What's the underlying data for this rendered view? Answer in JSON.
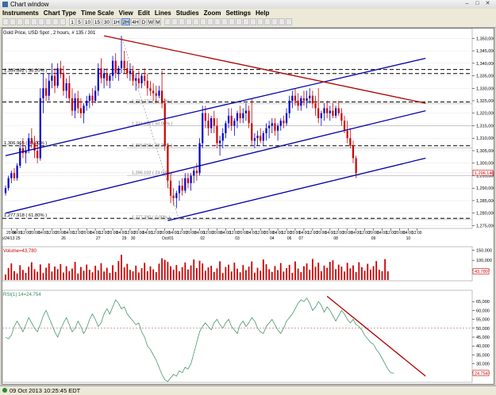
{
  "window": {
    "title": "Chart window"
  },
  "menu": [
    "Instruments",
    "Chart Type",
    "Time Scale",
    "View",
    "Edit",
    "Lines",
    "Studies",
    "Zoom",
    "Settings",
    "Help"
  ],
  "toolbar": {
    "timeframes": [
      "1",
      "5",
      "10",
      "15",
      "30",
      "1H",
      "2H",
      "4H",
      "D",
      "W",
      "M"
    ],
    "active_timeframe": "2H"
  },
  "chart_header": "Gold Price, USD Spot , 2 hours, # 135 / 301",
  "colors": {
    "bull": "#0000cc",
    "bear": "#cc0000",
    "volume": "#cc0000",
    "rsi": "#2e8b57",
    "channel": "#0000aa",
    "trendline": "#b00000",
    "dashed": "#000000",
    "fib": "#9a9a9a",
    "current": "#cc0000"
  },
  "price_axis": [
    {
      "v": 1350000,
      "label": "1,350,000"
    },
    {
      "v": 1345000,
      "label": "1,345,000"
    },
    {
      "v": 1340000,
      "label": "1,340,000"
    },
    {
      "v": 1335000,
      "label": "1,335,000"
    },
    {
      "v": 1330000,
      "label": "1,330,000"
    },
    {
      "v": 1325000,
      "label": "1,325,000"
    },
    {
      "v": 1320000,
      "label": "1,320,000"
    },
    {
      "v": 1315000,
      "label": "1,315,000"
    },
    {
      "v": 1310000,
      "label": "1,310,000"
    },
    {
      "v": 1305000,
      "label": "1,305,000"
    },
    {
      "v": 1300000,
      "label": "1,300,000"
    },
    {
      "v": 1295000,
      "label": "1,295,000"
    },
    {
      "v": 1290000,
      "label": "1,290,000"
    },
    {
      "v": 1285000,
      "label": "1,285,000"
    },
    {
      "v": 1280000,
      "label": "1,280,000"
    },
    {
      "v": 1275000,
      "label": "1,275,000"
    }
  ],
  "current_price": {
    "value": 1296140,
    "label": "1,296,140"
  },
  "fib_levels": [
    {
      "v": 1335882,
      "label": "1,335.882 ( 38.20% )",
      "pos": "left",
      "style": "dashed"
    },
    {
      "v": 1323771,
      "label": "1,323.771 ( 61.80% )",
      "pos": "mid",
      "style": "fib"
    },
    {
      "v": 1314915,
      "label": "1,314.915 ( 50.00% )",
      "pos": "mid",
      "style": "fib"
    },
    {
      "v": 1306965,
      "label": "1,306.965 ( 50.00% )",
      "pos": "left",
      "style": "dashed"
    },
    {
      "v": 1306059,
      "label": "1,306.059 ( 38.20% )",
      "pos": "mid",
      "style": "fib"
    },
    {
      "v": 1295102,
      "label": "1,295.102 ( 23.60% )",
      "pos": "mid",
      "style": "fib"
    },
    {
      "v": 1277918,
      "label": "1,277.918 ( 61.80% )",
      "pos": "left",
      "style": "dashed"
    },
    {
      "v": 1277390,
      "label": "1,277.390 ( 0.00% )",
      "pos": "mid",
      "style": "fib"
    }
  ],
  "extra_dashed": [
    1337500,
    1324500
  ],
  "time_axis": {
    "top": [
      {
        "i": 2,
        "t": "20:00"
      },
      {
        "i": 4,
        "t": "04:00"
      },
      {
        "i": 7,
        "t": "12:00"
      },
      {
        "i": 10,
        "t": "20:00"
      },
      {
        "i": 13,
        "t": "04:00"
      },
      {
        "i": 16,
        "t": "12:00"
      },
      {
        "i": 19,
        "t": "20:00"
      },
      {
        "i": 22,
        "t": "04:00"
      },
      {
        "i": 25,
        "t": "12:00"
      },
      {
        "i": 28,
        "t": "20:00"
      },
      {
        "i": 31,
        "t": "04:00"
      },
      {
        "i": 34,
        "t": "12:00"
      },
      {
        "i": 37,
        "t": "20:00"
      },
      {
        "i": 40,
        "t": "04:00"
      },
      {
        "i": 43,
        "t": "12:00"
      },
      {
        "i": 46,
        "t": "20:00"
      },
      {
        "i": 49,
        "t": "04:00"
      },
      {
        "i": 52,
        "t": "12:00"
      },
      {
        "i": 55,
        "t": "20:00"
      },
      {
        "i": 58,
        "t": "04:00"
      },
      {
        "i": 61,
        "t": "12:00"
      },
      {
        "i": 64,
        "t": "20:00"
      },
      {
        "i": 67,
        "t": "04:00"
      },
      {
        "i": 70,
        "t": "12:00"
      },
      {
        "i": 73,
        "t": "20:00"
      },
      {
        "i": 76,
        "t": "04:00"
      },
      {
        "i": 79,
        "t": "12:00"
      },
      {
        "i": 82,
        "t": "20:00"
      },
      {
        "i": 85,
        "t": "04:00"
      },
      {
        "i": 88,
        "t": "12:00"
      },
      {
        "i": 91,
        "t": "20:00"
      },
      {
        "i": 94,
        "t": "04:00"
      },
      {
        "i": 97,
        "t": "12:00"
      },
      {
        "i": 100,
        "t": "20:00"
      },
      {
        "i": 103,
        "t": "04:00"
      },
      {
        "i": 106,
        "t": "12:00"
      },
      {
        "i": 109,
        "t": "20:00"
      },
      {
        "i": 112,
        "t": "04:00"
      },
      {
        "i": 115,
        "t": "12:00"
      },
      {
        "i": 118,
        "t": "20:00"
      },
      {
        "i": 121,
        "t": "04:00"
      },
      {
        "i": 124,
        "t": "12:00"
      },
      {
        "i": 127,
        "t": "20:00"
      },
      {
        "i": 130,
        "t": "04:00"
      },
      {
        "i": 133,
        "t": "12:00"
      },
      {
        "i": 136,
        "t": "20:00"
      },
      {
        "i": 139,
        "t": "04:00"
      },
      {
        "i": 142,
        "t": "12:00"
      }
    ],
    "bottom": [
      {
        "i": 1,
        "t": "Sep/24/13 25"
      },
      {
        "i": 20,
        "t": "26"
      },
      {
        "i": 32,
        "t": "27"
      },
      {
        "i": 41,
        "t": "29"
      },
      {
        "i": 44,
        "t": "30"
      },
      {
        "i": 56,
        "t": "Oct/01"
      },
      {
        "i": 68,
        "t": "02"
      },
      {
        "i": 80,
        "t": "03"
      },
      {
        "i": 92,
        "t": "04"
      },
      {
        "i": 98,
        "t": "06"
      },
      {
        "i": 102,
        "t": "07"
      },
      {
        "i": 114,
        "t": "08"
      },
      {
        "i": 127,
        "t": "09"
      },
      {
        "i": 139,
        "t": "10"
      }
    ]
  },
  "volume_panel": {
    "label": "Volume=43,780",
    "axis": [
      {
        "v": 150000,
        "label": "150,000"
      },
      {
        "v": 100000,
        "label": "100,000"
      },
      {
        "v": 50000,
        "label": "50,000"
      }
    ],
    "current_label": "43,780",
    "values": [
      28000,
      61000,
      84000,
      45000,
      33000,
      75000,
      51000,
      36000,
      67000,
      90000,
      55000,
      42000,
      79000,
      35000,
      62000,
      84000,
      43000,
      68000,
      55000,
      81000,
      38000,
      70000,
      45000,
      58000,
      92000,
      33000,
      66000,
      47000,
      78000,
      52000,
      39000,
      72000,
      49000,
      85000,
      43000,
      62000,
      36000,
      75000,
      41000,
      96000,
      128000,
      64000,
      82000,
      51000,
      44000,
      73000,
      38000,
      60000,
      87000,
      45000,
      69000,
      54000,
      40000,
      83000,
      110000,
      102000,
      92000,
      70000,
      52000,
      76000,
      44000,
      65000,
      89000,
      53000,
      74000,
      104000,
      60000,
      98000,
      84000,
      47000,
      64000,
      72000,
      41000,
      59000,
      95000,
      35000,
      66000,
      78000,
      43000,
      88000,
      57000,
      39000,
      76000,
      50000,
      68000,
      94000,
      37000,
      62000,
      47000,
      104000,
      80000,
      55000,
      41000,
      71000,
      50000,
      86000,
      43000,
      60000,
      77000,
      36000,
      94000,
      58000,
      40000,
      70000,
      84000,
      52000,
      107000,
      67000,
      88000,
      45000,
      73000,
      62000,
      92000,
      100000,
      55000,
      78000,
      68000,
      43000,
      87000,
      59000,
      74000,
      40000,
      90000,
      65000,
      47000,
      82000,
      53000,
      70000,
      96000,
      52000,
      45000,
      106000,
      43780
    ]
  },
  "rsi_panel": {
    "label": "RSI(1) 14=24.754",
    "axis": [
      {
        "v": 65,
        "label": "65,000"
      },
      {
        "v": 60,
        "label": "60,000"
      },
      {
        "v": 55,
        "label": "55,000"
      },
      {
        "v": 50,
        "label": "50,000"
      },
      {
        "v": 45,
        "label": "45,000"
      },
      {
        "v": 40,
        "label": "40,000"
      },
      {
        "v": 35,
        "label": "35,000"
      },
      {
        "v": 30,
        "label": "30,000"
      },
      {
        "v": 25,
        "label": "25,000"
      }
    ],
    "current_label": "24.754",
    "values": [
      45,
      44,
      46,
      51,
      54,
      51,
      48,
      52,
      56,
      53,
      50,
      48,
      52,
      57,
      60,
      56,
      52,
      48,
      45,
      49,
      53,
      56,
      52,
      48,
      50,
      54,
      51,
      47,
      50,
      55,
      58,
      55,
      51,
      53,
      58,
      61,
      58,
      62,
      66,
      64,
      61,
      62,
      58,
      56,
      54,
      52,
      53,
      48,
      45,
      40,
      38,
      35,
      32,
      28,
      24,
      21,
      20,
      22,
      24,
      23,
      26,
      25,
      28,
      27,
      30,
      36,
      42,
      48,
      51,
      53,
      51,
      49,
      53,
      55,
      52,
      50,
      53,
      55,
      51,
      49,
      47,
      52,
      54,
      51,
      53,
      56,
      54,
      50,
      48,
      47,
      51,
      53,
      55,
      52,
      49,
      47,
      50,
      54,
      56,
      58,
      61,
      64,
      66,
      65,
      67,
      64,
      60,
      62,
      65,
      63,
      59,
      62,
      60,
      57,
      54,
      57,
      60,
      58,
      55,
      53,
      55,
      52,
      51,
      49,
      46,
      44,
      42,
      41,
      38,
      36,
      33,
      30,
      27,
      25,
      24.754
    ]
  },
  "candles": [
    [
      1288,
      1291,
      1287,
      1290
    ],
    [
      1290,
      1295,
      1289,
      1294
    ],
    [
      1294,
      1297,
      1292,
      1296
    ],
    [
      1296,
      1298,
      1293,
      1294
    ],
    [
      1294,
      1300,
      1293,
      1299
    ],
    [
      1299,
      1308,
      1298,
      1306
    ],
    [
      1306,
      1310,
      1302,
      1304
    ],
    [
      1304,
      1307,
      1300,
      1305
    ],
    [
      1305,
      1312,
      1304,
      1310
    ],
    [
      1310,
      1314,
      1306,
      1308
    ],
    [
      1308,
      1311,
      1302,
      1305
    ],
    [
      1305,
      1309,
      1300,
      1302
    ],
    [
      1302,
      1330,
      1301,
      1326
    ],
    [
      1326,
      1336,
      1320,
      1330
    ],
    [
      1330,
      1334,
      1325,
      1327
    ],
    [
      1327,
      1336,
      1325,
      1333
    ],
    [
      1333,
      1340,
      1330,
      1335
    ],
    [
      1335,
      1338,
      1328,
      1331
    ],
    [
      1331,
      1340,
      1330,
      1338
    ],
    [
      1338,
      1341,
      1334,
      1336
    ],
    [
      1336,
      1339,
      1327,
      1329
    ],
    [
      1329,
      1334,
      1326,
      1332
    ],
    [
      1332,
      1335,
      1324,
      1326
    ],
    [
      1326,
      1330,
      1319,
      1321
    ],
    [
      1321,
      1328,
      1318,
      1326
    ],
    [
      1326,
      1329,
      1320,
      1322
    ],
    [
      1322,
      1326,
      1318,
      1320
    ],
    [
      1320,
      1324,
      1316,
      1323
    ],
    [
      1323,
      1327,
      1321,
      1325
    ],
    [
      1325,
      1328,
      1322,
      1327
    ],
    [
      1327,
      1330,
      1323,
      1325
    ],
    [
      1325,
      1331,
      1324,
      1329
    ],
    [
      1329,
      1340,
      1327,
      1338
    ],
    [
      1338,
      1342,
      1332,
      1334
    ],
    [
      1334,
      1338,
      1330,
      1336
    ],
    [
      1336,
      1338,
      1331,
      1333
    ],
    [
      1333,
      1336,
      1330,
      1335
    ],
    [
      1335,
      1343,
      1333,
      1341
    ],
    [
      1341,
      1344,
      1334,
      1336
    ],
    [
      1336,
      1339,
      1333,
      1338
    ],
    [
      1338,
      1351,
      1336,
      1341
    ],
    [
      1341,
      1345,
      1336,
      1338
    ],
    [
      1338,
      1341,
      1334,
      1336
    ],
    [
      1336,
      1340,
      1333,
      1337
    ],
    [
      1337,
      1339,
      1331,
      1333
    ],
    [
      1333,
      1336,
      1329,
      1334
    ],
    [
      1334,
      1337,
      1330,
      1332
    ],
    [
      1332,
      1336,
      1330,
      1335
    ],
    [
      1335,
      1338,
      1331,
      1333
    ],
    [
      1333,
      1336,
      1327,
      1330
    ],
    [
      1330,
      1333,
      1327,
      1329
    ],
    [
      1329,
      1332,
      1325,
      1328
    ],
    [
      1328,
      1331,
      1324,
      1327
    ],
    [
      1327,
      1331,
      1326,
      1329
    ],
    [
      1329,
      1337,
      1322,
      1324
    ],
    [
      1324,
      1326,
      1305,
      1307
    ],
    [
      1307,
      1308,
      1290,
      1293
    ],
    [
      1293,
      1296,
      1284,
      1287
    ],
    [
      1287,
      1290,
      1283,
      1286
    ],
    [
      1286,
      1289,
      1282,
      1288
    ],
    [
      1288,
      1293,
      1285,
      1291
    ],
    [
      1291,
      1294,
      1287,
      1289
    ],
    [
      1289,
      1296,
      1288,
      1294
    ],
    [
      1294,
      1296,
      1290,
      1292
    ],
    [
      1292,
      1296,
      1289,
      1295
    ],
    [
      1295,
      1298,
      1292,
      1297
    ],
    [
      1297,
      1300,
      1293,
      1296
    ],
    [
      1296,
      1310,
      1295,
      1308
    ],
    [
      1308,
      1323,
      1306,
      1320
    ],
    [
      1320,
      1323,
      1314,
      1317
    ],
    [
      1317,
      1320,
      1311,
      1314
    ],
    [
      1314,
      1319,
      1312,
      1318
    ],
    [
      1318,
      1321,
      1312,
      1315
    ],
    [
      1315,
      1318,
      1306,
      1308
    ],
    [
      1308,
      1311,
      1303,
      1309
    ],
    [
      1309,
      1314,
      1306,
      1312
    ],
    [
      1312,
      1317,
      1310,
      1316
    ],
    [
      1316,
      1322,
      1314,
      1319
    ],
    [
      1319,
      1322,
      1313,
      1315
    ],
    [
      1315,
      1318,
      1311,
      1317
    ],
    [
      1317,
      1321,
      1314,
      1320
    ],
    [
      1320,
      1323,
      1316,
      1318
    ],
    [
      1318,
      1322,
      1316,
      1320
    ],
    [
      1320,
      1324,
      1317,
      1321
    ],
    [
      1321,
      1323,
      1314,
      1316
    ],
    [
      1316,
      1326,
      1307,
      1309
    ],
    [
      1309,
      1312,
      1306,
      1310
    ],
    [
      1310,
      1313,
      1307,
      1311
    ],
    [
      1311,
      1314,
      1308,
      1309
    ],
    [
      1309,
      1313,
      1307,
      1312
    ],
    [
      1312,
      1316,
      1309,
      1314
    ],
    [
      1314,
      1317,
      1310,
      1315
    ],
    [
      1315,
      1318,
      1312,
      1316
    ],
    [
      1316,
      1318,
      1311,
      1313
    ],
    [
      1313,
      1316,
      1309,
      1315
    ],
    [
      1315,
      1318,
      1313,
      1317
    ],
    [
      1317,
      1319,
      1314,
      1316
    ],
    [
      1316,
      1322,
      1315,
      1320
    ],
    [
      1320,
      1327,
      1318,
      1325
    ],
    [
      1325,
      1329,
      1322,
      1327
    ],
    [
      1327,
      1330,
      1323,
      1325
    ],
    [
      1325,
      1328,
      1321,
      1323
    ],
    [
      1323,
      1327,
      1321,
      1326
    ],
    [
      1326,
      1329,
      1323,
      1325
    ],
    [
      1325,
      1329,
      1322,
      1326
    ],
    [
      1326,
      1330,
      1324,
      1327
    ],
    [
      1327,
      1329,
      1322,
      1324
    ],
    [
      1324,
      1327,
      1319,
      1322
    ],
    [
      1322,
      1330,
      1316,
      1318
    ],
    [
      1318,
      1321,
      1315,
      1320
    ],
    [
      1320,
      1324,
      1317,
      1322
    ],
    [
      1322,
      1325,
      1318,
      1320
    ],
    [
      1320,
      1323,
      1317,
      1321
    ],
    [
      1321,
      1324,
      1318,
      1319
    ],
    [
      1319,
      1323,
      1318,
      1322
    ],
    [
      1322,
      1325,
      1319,
      1320
    ],
    [
      1320,
      1322,
      1315,
      1317
    ],
    [
      1317,
      1319,
      1312,
      1313
    ],
    [
      1313,
      1317,
      1308,
      1310
    ],
    [
      1310,
      1314,
      1306,
      1307
    ],
    [
      1307,
      1309,
      1300,
      1302
    ],
    [
      1302,
      1303,
      1294,
      1296
    ]
  ],
  "channel_lines": [
    {
      "i1": 0,
      "p1": 1303,
      "i2": 145,
      "p2": 1342
    },
    {
      "i1": 0,
      "p1": 1280,
      "i2": 145,
      "p2": 1321
    },
    {
      "i1": 56,
      "p1": 1277,
      "i2": 145,
      "p2": 1302
    }
  ],
  "trend_line": {
    "i1": 34,
    "p1": 1351,
    "i2": 145,
    "p2": 1324
  },
  "rsi_trend": {
    "i1": 111,
    "v1": 68,
    "i2": 145,
    "v2": 23
  },
  "fib_diagonal": {
    "i1": 40,
    "p1": 1351,
    "i2": 60,
    "p2": 1277
  }
}
